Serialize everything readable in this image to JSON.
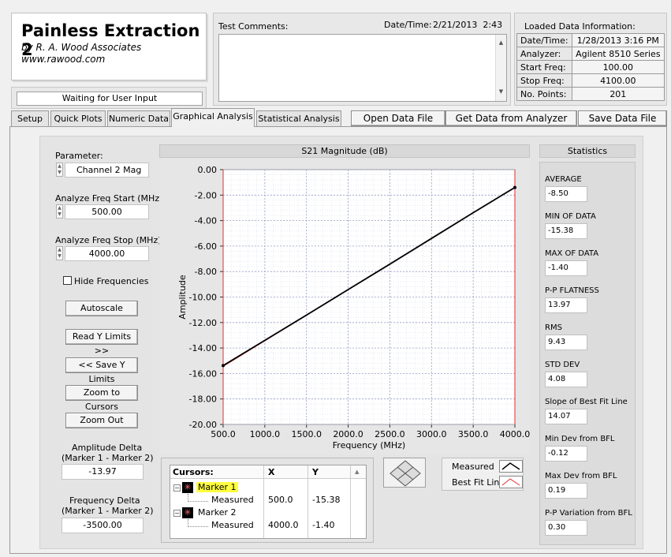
{
  "app": {
    "title": "Painless Extraction 2",
    "author": "by R. A. Wood Associates",
    "website": "www.rawood.com"
  },
  "status": "Waiting for User Input",
  "comments": {
    "label": "Test Comments:",
    "value": ""
  },
  "datetime": {
    "label": "Date/Time:",
    "value": "2/21/2013  2:43"
  },
  "loaded_info": {
    "title": "Loaded Data Information:",
    "rows": [
      {
        "key": "Date/Time:",
        "value": "1/28/2013 3:16 PM"
      },
      {
        "key": "Analyzer:",
        "value": "Agilent 8510 Series"
      },
      {
        "key": "Start Freq:",
        "value": "100.00"
      },
      {
        "key": "Stop Freq:",
        "value": "4100.00"
      },
      {
        "key": "No. Points:",
        "value": "201"
      }
    ]
  },
  "tabs": [
    "Setup",
    "Quick Plots",
    "Numeric Data",
    "Graphical Analysis",
    "Statistical Analysis"
  ],
  "toolbar": {
    "open": "Open Data File",
    "get": "Get Data from Analyzer",
    "save": "Save Data File"
  },
  "controls": {
    "parameter_label": "Parameter:",
    "parameter_value": "Channel 2 Mag",
    "start_label": "Analyze Freq Start (MHz)",
    "start_value": "500.00",
    "stop_label": "Analyze Freq Stop (MHz)",
    "stop_value": "4000.00",
    "hide_freq": "Hide Frequencies",
    "autoscale": "Autoscale",
    "read_y": "Read Y Limits >>",
    "save_y": "<< Save Y Limits",
    "zoom_cursors": "Zoom to Cursors",
    "zoom_out": "Zoom Out",
    "amp_delta_label1": "Amplitude Delta",
    "amp_delta_label2": "(Marker 1 - Marker 2)",
    "amp_delta_value": "-13.97",
    "freq_delta_label1": "Frequency Delta",
    "freq_delta_label2": "(Marker 1 - Marker 2)",
    "freq_delta_value": "-3500.00"
  },
  "cursors": {
    "header": [
      "Cursors:",
      "X",
      "Y"
    ],
    "items": [
      {
        "name": "Marker 1",
        "sub": "Measured",
        "x": "500.0",
        "y": "-15.38"
      },
      {
        "name": "Marker 2",
        "sub": "Measured",
        "x": "4000.0",
        "y": "-1.40"
      }
    ]
  },
  "legend": {
    "measured": "Measured",
    "bestfit": "Best Fit Line"
  },
  "statistics": {
    "title": "Statistics",
    "items": [
      {
        "label": "AVERAGE",
        "value": "-8.50"
      },
      {
        "label": "MIN OF DATA",
        "value": "-15.38"
      },
      {
        "label": "MAX OF DATA",
        "value": "-1.40"
      },
      {
        "label": "P-P FLATNESS",
        "value": "13.97"
      },
      {
        "label": "RMS",
        "value": "9.43"
      },
      {
        "label": "STD DEV",
        "value": "4.08"
      },
      {
        "label": "Slope of Best Fit Line",
        "value": "14.07"
      },
      {
        "label": "Min Dev from BFL",
        "value": "-0.12"
      },
      {
        "label": "Max Dev from BFL",
        "value": "0.19"
      },
      {
        "label": "P-P Variation from BFL",
        "value": "0.30"
      }
    ]
  },
  "colors": {
    "measured": "#000000",
    "bestfit": "#e03030",
    "marker_highlight": "#ffff40",
    "grid": "#9aa0c8"
  },
  "chart_data": {
    "type": "line",
    "title": "S21 Magnitude (dB)",
    "xlabel": "Frequency (MHz)",
    "ylabel": "Amplitude",
    "xlim": [
      500,
      4000
    ],
    "ylim": [
      -20,
      0
    ],
    "x_ticks": [
      "500.0",
      "1000.0",
      "1500.0",
      "2000.0",
      "2500.0",
      "3000.0",
      "3500.0",
      "4000.0"
    ],
    "y_ticks": [
      "0.00",
      "-2.00",
      "-4.00",
      "-6.00",
      "-8.00",
      "-10.00",
      "-12.00",
      "-14.00",
      "-16.00",
      "-18.00",
      "-20.00"
    ],
    "grid": true,
    "series": [
      {
        "name": "Measured",
        "x": [
          500,
          1000,
          1500,
          2000,
          2500,
          3000,
          3500,
          4000
        ],
        "y": [
          -15.38,
          -13.4,
          -11.42,
          -9.41,
          -7.42,
          -5.4,
          -3.38,
          -1.4
        ]
      },
      {
        "name": "Best Fit Line",
        "x": [
          500,
          4000
        ],
        "y": [
          -15.45,
          -1.38
        ]
      }
    ],
    "markers": [
      {
        "x": 500,
        "y": -15.38
      },
      {
        "x": 4000,
        "y": -1.4
      }
    ]
  }
}
